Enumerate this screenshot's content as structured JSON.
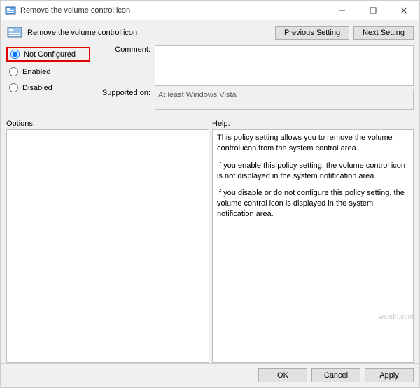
{
  "window": {
    "title": "Remove the volume control icon"
  },
  "header": {
    "title": "Remove the volume control icon",
    "prev_btn": "Previous Setting",
    "next_btn": "Next Setting"
  },
  "radios": {
    "not_configured": "Not Configured",
    "enabled": "Enabled",
    "disabled": "Disabled",
    "selected": "not_configured"
  },
  "fields": {
    "comment_label": "Comment:",
    "comment_value": "",
    "supported_label": "Supported on:",
    "supported_value": "At least Windows Vista"
  },
  "sections": {
    "options_label": "Options:",
    "help_label": "Help:"
  },
  "help": {
    "p1": "This policy setting allows you to remove the volume control icon from the system control area.",
    "p2": "If you enable this policy setting, the volume control icon is not displayed in the system notification area.",
    "p3": "If you disable or do not configure this policy setting, the volume control icon is displayed in the system notification area."
  },
  "footer": {
    "ok": "OK",
    "cancel": "Cancel",
    "apply": "Apply"
  },
  "watermark": "wsxdn.com"
}
